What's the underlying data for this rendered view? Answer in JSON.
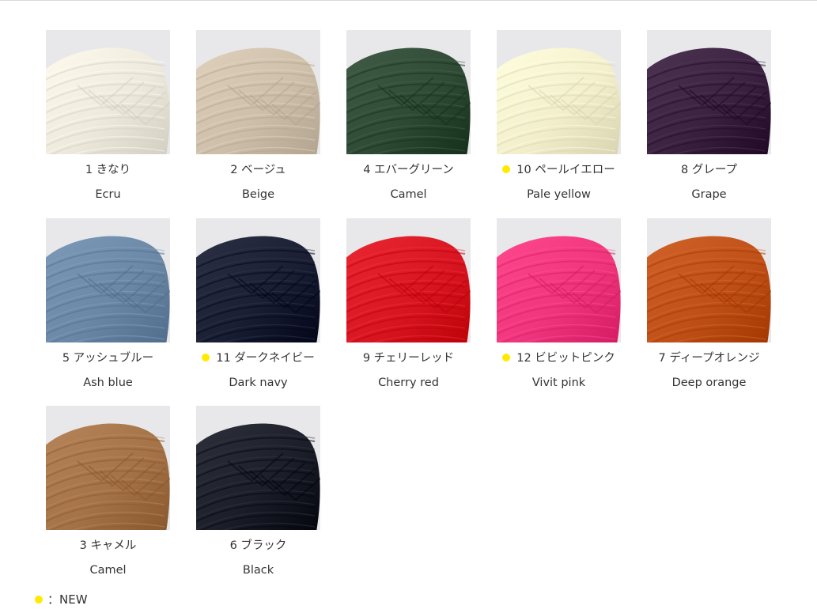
{
  "accent_colors": {
    "new_dot": "#ffea00",
    "photo_background": "#e8e8ea"
  },
  "swatches": [
    {
      "label_ja": "1 きなり",
      "label_en": "Ecru",
      "is_new": false,
      "yarn_color": "#ede9dc"
    },
    {
      "label_ja": "2 ベージュ",
      "label_en": "Beige",
      "is_new": false,
      "yarn_color": "#cdbfaa"
    },
    {
      "label_ja": "4 エバーグリーン",
      "label_en": "Camel",
      "is_new": false,
      "yarn_color": "#2f4a35"
    },
    {
      "label_ja": "10 ペールイエロー",
      "label_en": "Pale yellow",
      "is_new": true,
      "yarn_color": "#f3efcc"
    },
    {
      "label_ja": "8 グレープ",
      "label_en": "Grape",
      "is_new": false,
      "yarn_color": "#3a2240"
    },
    {
      "label_ja": "5 アッシュブルー",
      "label_en": "Ash blue",
      "is_new": false,
      "yarn_color": "#6b88a6"
    },
    {
      "label_ja": "11 ダークネイビー",
      "label_en": "Dark navy",
      "is_new": true,
      "yarn_color": "#1a1f33"
    },
    {
      "label_ja": "9 チェリーレッド",
      "label_en": "Cherry red",
      "is_new": false,
      "yarn_color": "#d81622"
    },
    {
      "label_ja": "12 ビビットピンク",
      "label_en": "Vivit pink",
      "is_new": true,
      "yarn_color": "#f0367c"
    },
    {
      "label_ja": "7 ディープオレンジ",
      "label_en": "Deep orange",
      "is_new": false,
      "yarn_color": "#bf5118"
    },
    {
      "label_ja": "3 キャメル",
      "label_en": "Camel",
      "is_new": false,
      "yarn_color": "#a57348"
    },
    {
      "label_ja": "6 ブラック",
      "label_en": "Black",
      "is_new": false,
      "yarn_color": "#1c1f29"
    }
  ],
  "legend": {
    "text": "：NEW"
  }
}
